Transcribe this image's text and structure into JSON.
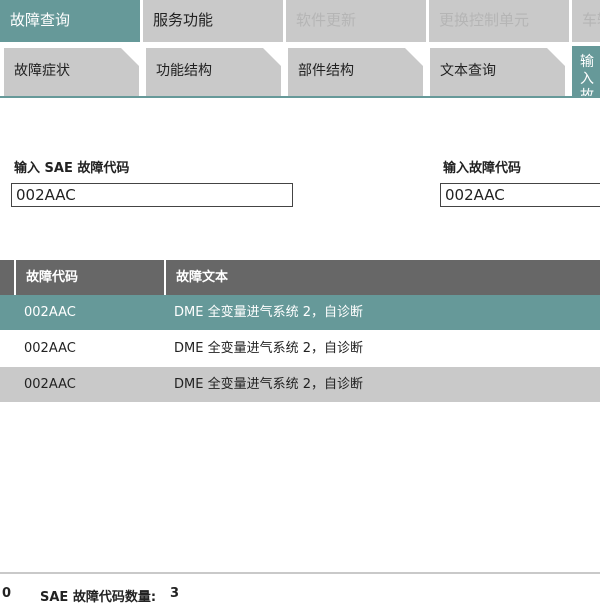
{
  "top_tabs": [
    "故障查询",
    "服务功能",
    "软件更新",
    "更换控制单元",
    "车辆"
  ],
  "sub_tabs": [
    "故障症状",
    "功能结构",
    "部件结构",
    "文本查询",
    "输入故障码"
  ],
  "sae_input": {
    "label": "输入 SAE 故障代码",
    "value": "002AAC"
  },
  "code_input": {
    "label": "输入故障代码",
    "value": "002AAC"
  },
  "table": {
    "headers": [
      "故障代码",
      "故障文本"
    ],
    "rows": [
      {
        "code": "002AAC",
        "text": "DME 全变量进气系统 2，自诊断"
      },
      {
        "code": "002AAC",
        "text": "DME 全变量进气系统 2，自诊断"
      },
      {
        "code": "002AAC",
        "text": "DME 全变量进气系统 2，自诊断"
      }
    ]
  },
  "status": {
    "left_value": "0",
    "sae_count_label": "SAE 故障代码数量:",
    "sae_count_value": "3"
  },
  "colors": {
    "accent": "#669999",
    "tab_bg": "#c9c9c9",
    "header_bg": "#676767"
  }
}
